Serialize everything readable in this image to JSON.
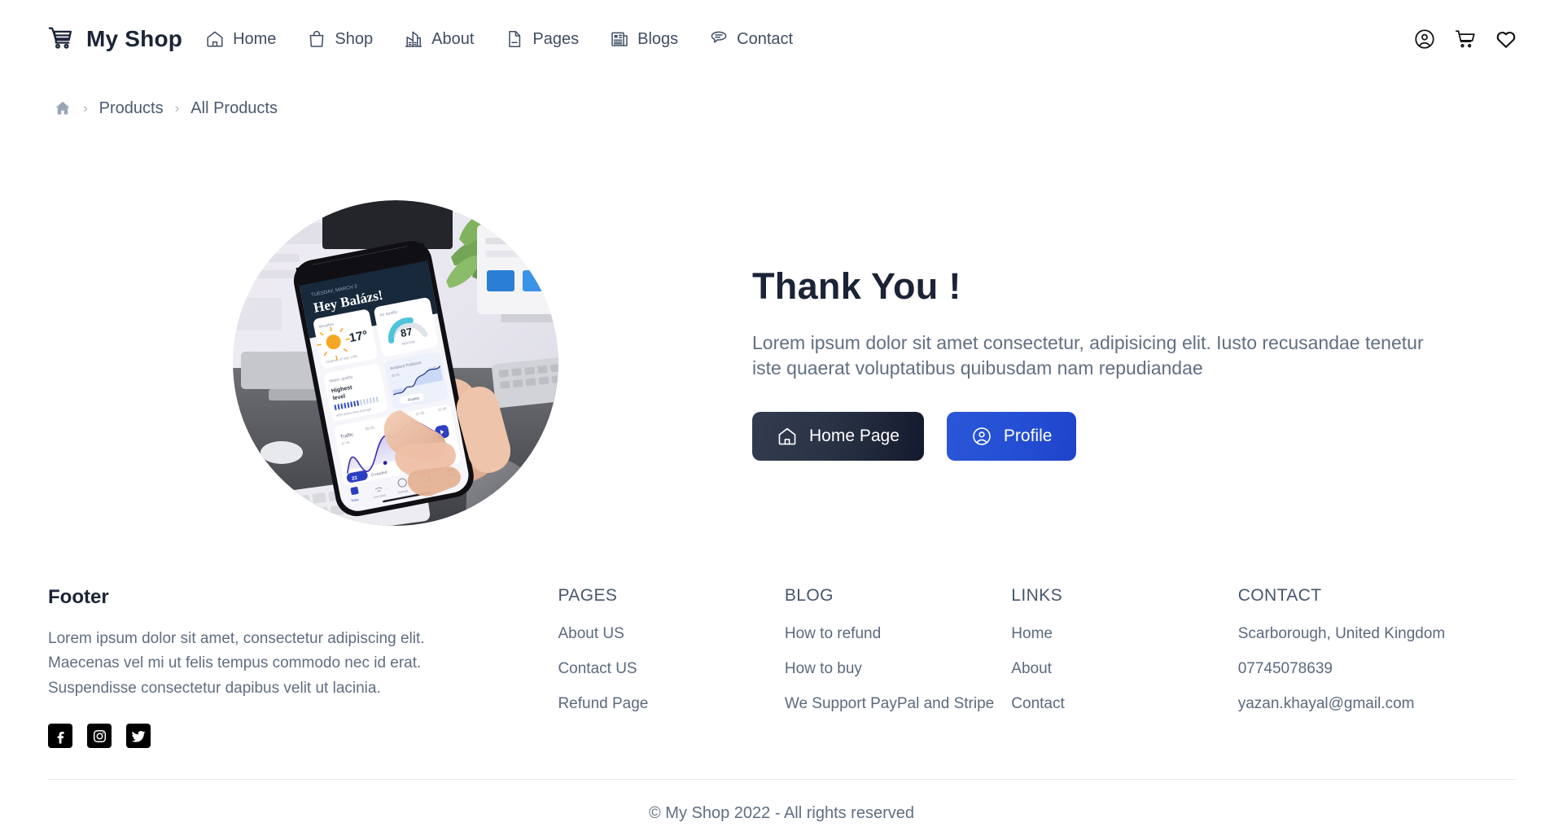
{
  "header": {
    "logo": {
      "icon": "shopping-cart-icon",
      "text": "My Shop"
    },
    "nav": [
      {
        "icon": "home-icon",
        "label": "Home"
      },
      {
        "icon": "shopping-bag-icon",
        "label": "Shop"
      },
      {
        "icon": "building-icon",
        "label": "About"
      },
      {
        "icon": "document-icon",
        "label": "Pages"
      },
      {
        "icon": "newspaper-icon",
        "label": "Blogs"
      },
      {
        "icon": "chat-bubble-icon",
        "label": "Contact"
      }
    ],
    "actions": [
      {
        "icon": "user-circle-icon",
        "name": "account-button"
      },
      {
        "icon": "shopping-cart-icon",
        "name": "cart-button"
      },
      {
        "icon": "heart-icon",
        "name": "wishlist-button"
      }
    ]
  },
  "breadcrumb": {
    "home_icon": "home-filled-icon",
    "separator": "›",
    "items": [
      {
        "label": "Products"
      },
      {
        "label": "All Products"
      }
    ]
  },
  "hero": {
    "image_alt": "hand-holding-smartphone-dashboard",
    "title": "Thank You !",
    "subtitle": "Lorem ipsum dolor sit amet consectetur, adipisicing elit. Iusto recusandae tenetur iste quaerat voluptatibus quibusdam nam repudiandae",
    "buttons": [
      {
        "label": "Home Page",
        "icon": "home-outline-icon",
        "style": "dark"
      },
      {
        "label": "Profile",
        "icon": "user-circle-icon",
        "style": "blue"
      }
    ]
  },
  "footer": {
    "brand_title": "Footer",
    "brand_desc": "Lorem ipsum dolor sit amet, consectetur adipiscing elit. Maecenas vel mi ut felis tempus commodo nec id erat. Suspendisse consectetur dapibus velit ut lacinia.",
    "socials": [
      {
        "icon": "facebook-icon",
        "name": "facebook"
      },
      {
        "icon": "instagram-icon",
        "name": "instagram"
      },
      {
        "icon": "twitter-icon",
        "name": "twitter"
      }
    ],
    "columns": [
      {
        "heading": "PAGES",
        "links": [
          "About US",
          "Contact US",
          "Refund Page"
        ]
      },
      {
        "heading": "BLOG",
        "links": [
          "How to refund",
          "How to buy",
          "We Support PayPal and Stripe"
        ]
      },
      {
        "heading": "LINKS",
        "links": [
          "Home",
          "About",
          "Contact"
        ]
      },
      {
        "heading": "CONTACT",
        "links": [
          "Scarborough, United Kingdom",
          "07745078639",
          "yazan.khayal@gmail.com"
        ]
      }
    ],
    "copyright": "© My Shop 2022 - All rights reserved"
  },
  "colors": {
    "brand_dark": "#1b2437",
    "nav_text": "#3f4e63",
    "muted_text": "#5f6e82",
    "btn_dark_start": "#333c4f",
    "btn_dark_end": "#141a2e",
    "btn_blue_start": "#2b56d6",
    "btn_blue_end": "#1f43c9",
    "divider": "#e7e9ee"
  }
}
